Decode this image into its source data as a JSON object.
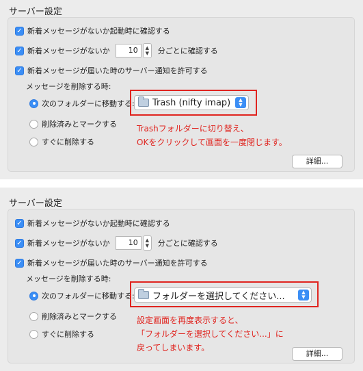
{
  "panels": [
    {
      "title": "サーバー設定",
      "check_startup": "新着メッセージがないか起動時に確認する",
      "check_interval_prefix": "新着メッセージがないか",
      "interval_value": "10",
      "check_interval_suffix": "分ごとに確認する",
      "notify_label": "新着メッセージが届いた時のサーバー通知を許可する",
      "delete_heading": "メッセージを削除する時:",
      "radio_move": "次のフォルダーに移動する:",
      "radio_mark": "削除済みとマークする",
      "radio_delete": "すぐに削除する",
      "folder_popup_value": "Trash (nifty imap)",
      "detail_button": "詳細...",
      "note_lines": [
        "Trashフォルダーに切り替え、",
        "OKをクリックして画面を一度閉じます。"
      ]
    },
    {
      "title": "サーバー設定",
      "check_startup": "新着メッセージがないか起動時に確認する",
      "check_interval_prefix": "新着メッセージがないか",
      "interval_value": "10",
      "check_interval_suffix": "分ごとに確認する",
      "notify_label": "新着メッセージが届いた時のサーバー通知を許可する",
      "delete_heading": "メッセージを削除する時:",
      "radio_move": "次のフォルダーに移動する:",
      "radio_mark": "削除済みとマークする",
      "radio_delete": "すぐに削除する",
      "folder_popup_value": "フォルダーを選択してください...",
      "detail_button": "詳細...",
      "note_lines": [
        "設定画面を再度表示すると、",
        "「フォルダーを選択してください...」に",
        "戻ってしまいます。"
      ]
    }
  ],
  "colors": {
    "accent": "#3b8ef5",
    "annotation": "#e0241f"
  },
  "icons": {
    "checkbox": "checkmark-icon",
    "folder": "folder-icon",
    "popup": "chevron-updown-icon"
  }
}
